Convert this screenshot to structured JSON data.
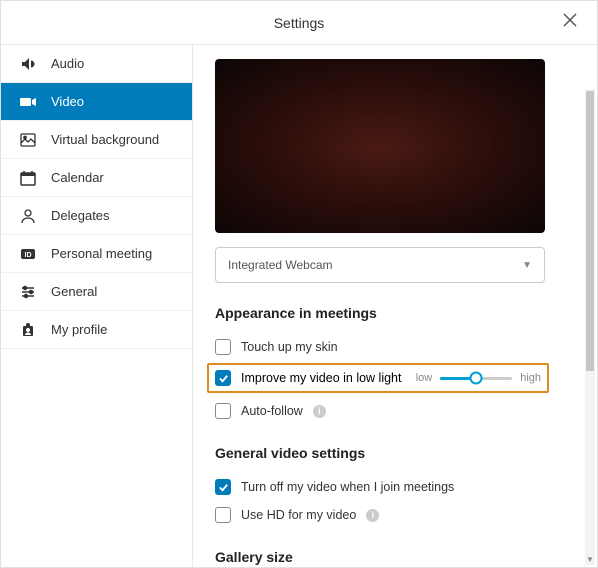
{
  "header": {
    "title": "Settings"
  },
  "sidebar": {
    "items": [
      {
        "label": "Audio"
      },
      {
        "label": "Video"
      },
      {
        "label": "Virtual background"
      },
      {
        "label": "Calendar"
      },
      {
        "label": "Delegates"
      },
      {
        "label": "Personal meeting"
      },
      {
        "label": "General"
      },
      {
        "label": "My profile"
      }
    ]
  },
  "content": {
    "camera_select": "Integrated Webcam",
    "section_appearance": "Appearance in meetings",
    "opt_touchup": "Touch up my skin",
    "opt_lowlight": "Improve my video in low light",
    "slider_low": "low",
    "slider_high": "high",
    "opt_autofollow": "Auto-follow",
    "section_general": "General video settings",
    "opt_turnoff": "Turn off my video when I join meetings",
    "opt_hd": "Use HD for my video",
    "section_gallery": "Gallery size"
  }
}
